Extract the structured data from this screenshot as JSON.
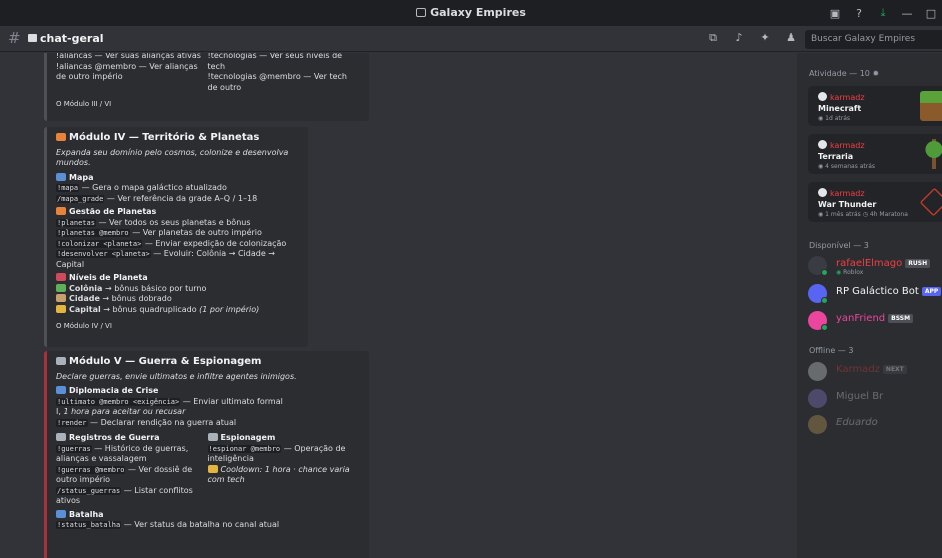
{
  "window": {
    "title": "Galaxy Empires"
  },
  "channel": {
    "name": "chat-geral",
    "search_placeholder": "Buscar Galaxy Empires"
  },
  "embed3": {
    "col1": [
      "!aliancas — Ver suas alianças ativas",
      "!aliancas @membro — Ver alianças de outro império"
    ],
    "col2": [
      "!tecnologias — Ver seus níveis de tech",
      "!tecnologias @membro — Ver tech de outro"
    ],
    "footer": "O Módulo III / VI"
  },
  "embed4": {
    "title": "Módulo IV — Território & Planetas",
    "desc": "Expanda seu domínio pelo cosmos, colonize e desenvolva mundos.",
    "f1_name": "Mapa",
    "f1_l1_code": "!mapa",
    "f1_l1_text": " — Gera o mapa galáctico atualizado",
    "f1_l2_code": "/mapa_grade",
    "f1_l2_text": " — Ver referência da grade A–Q / 1–18",
    "f2_name": "Gestão de Planetas",
    "f2_l1_code": "!planetas",
    "f2_l1_text": " — Ver todos os seus planetas e bônus",
    "f2_l2_code": "!planetas @membro",
    "f2_l2_text": " — Ver planetas de outro império",
    "f2_l3_code": "!colonizar <planeta>",
    "f2_l3_text": " — Enviar expedição de colonização",
    "f2_l4_code": "!desenvolver <planeta>",
    "f2_l4_text": " — Evoluir: Colônia → Cidade → Capital",
    "f3_name": "Níveis de Planeta",
    "f3_l1_b": "Colônia",
    "f3_l1_t": " → bônus básico por turno",
    "f3_l2_b": "Cidade",
    "f3_l2_t": " → bônus dobrado",
    "f3_l3_b": "Capital",
    "f3_l3_t": " → bônus quadruplicado ",
    "f3_l3_i": "(1 por império)",
    "footer": "O Módulo IV / VI"
  },
  "embed5": {
    "title": "Módulo V — Guerra & Espionagem",
    "desc": "Declare guerras, envie ultimatos e infiltre agentes inimigos.",
    "f1_name": "Diplomacia de Crise",
    "f1_l1_code": "!ultimato @membro <exigência>",
    "f1_l1_text": " — Enviar ultimato formal",
    "f1_l2_text": "I, ",
    "f1_l2_i": "1 hora para aceitar ou recusar",
    "f1_l3_code": "!render",
    "f1_l3_text": " — Declarar rendição na guerra atual",
    "f2_name": "Registros de Guerra",
    "f2_l1_code": "!guerras",
    "f2_l1_text": " — Histórico de guerras, alianças e vassalagem",
    "f2_l2_code": "!guerras @membro",
    "f2_l2_text": " — Ver dossiê de outro império",
    "f2_l3_code": "/status_guerras",
    "f2_l3_text": " — Listar conflitos ativos",
    "f3_name": "Espionagem",
    "f3_l1_code": "!espionar @membro",
    "f3_l1_text": " — Operação de inteligência",
    "f3_l2_i": "Cooldown: 1 hora · chance varia com tech",
    "f4_name": "Batalha",
    "f4_l1_code": "!status_batalha",
    "f4_l1_text": " — Ver status da batalha no canal atual"
  },
  "sidebar": {
    "activity_header": "Atividade — 10",
    "activities": [
      {
        "user": "karmadz",
        "game": "Minecraft",
        "meta": "1d atrás"
      },
      {
        "user": "karmadz",
        "game": "Terraria",
        "meta": "4 semanas atrás"
      },
      {
        "user": "karmadz",
        "game": "War Thunder",
        "meta": "1 mês atrás",
        "meta2": "4h Maratona"
      }
    ],
    "available_header": "Disponível — 3",
    "available": [
      {
        "name": "rafaelElmago",
        "badge": "RUSH",
        "sub": "Roblox"
      },
      {
        "name": "RP Galáctico Bot",
        "badge": "APP"
      },
      {
        "name": "yanFriend",
        "badge": "BSSM"
      }
    ],
    "offline_header": "Offline — 3",
    "offline": [
      {
        "name": "Karmadz",
        "badge": "NEXT"
      },
      {
        "name": "Miguel Br"
      },
      {
        "name": "Eduardo"
      }
    ]
  },
  "colors": {
    "accent": "#5865f2",
    "embed_red": "#a8323a",
    "online": "#23a55a",
    "username_red": "#f23f43"
  }
}
